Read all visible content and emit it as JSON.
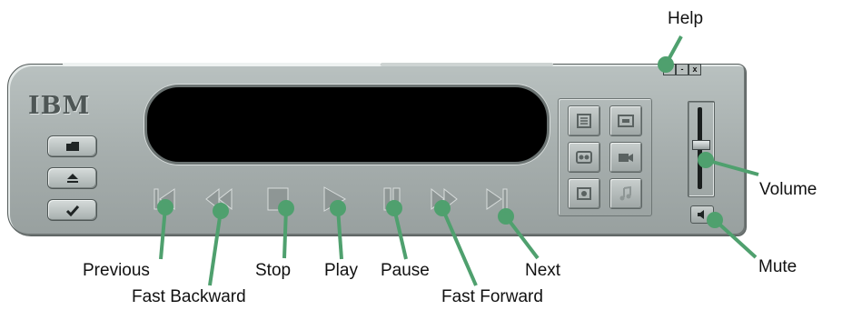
{
  "app": {
    "logo_text": "IBM",
    "help_glyph": "?",
    "minimize_glyph": "-",
    "close_glyph": "x"
  },
  "side_buttons": [
    {
      "name": "folder-icon"
    },
    {
      "name": "eject-icon"
    },
    {
      "name": "checkmark-icon"
    }
  ],
  "transport": [
    {
      "name": "previous-icon"
    },
    {
      "name": "fast-backward-icon"
    },
    {
      "name": "stop-icon"
    },
    {
      "name": "play-icon"
    },
    {
      "name": "pause-icon"
    },
    {
      "name": "fast-forward-icon"
    },
    {
      "name": "next-icon"
    }
  ],
  "panel_buttons": [
    {
      "name": "playlist-icon"
    },
    {
      "name": "tray-icon"
    },
    {
      "name": "tape-icon"
    },
    {
      "name": "camera-icon"
    },
    {
      "name": "speaker-settings-icon"
    },
    {
      "name": "music-note-icon"
    }
  ],
  "volume": {
    "level": 0.55
  },
  "labels": {
    "help": "Help",
    "volume": "Volume",
    "mute": "Mute",
    "previous": "Previous",
    "fast_backward": "Fast Backward",
    "stop": "Stop",
    "play": "Play",
    "pause": "Pause",
    "next": "Next",
    "fast_forward": "Fast Forward"
  },
  "colors": {
    "callout_green": "#4fa06e",
    "display": "#000000",
    "chrome": "#a9b1b0"
  }
}
